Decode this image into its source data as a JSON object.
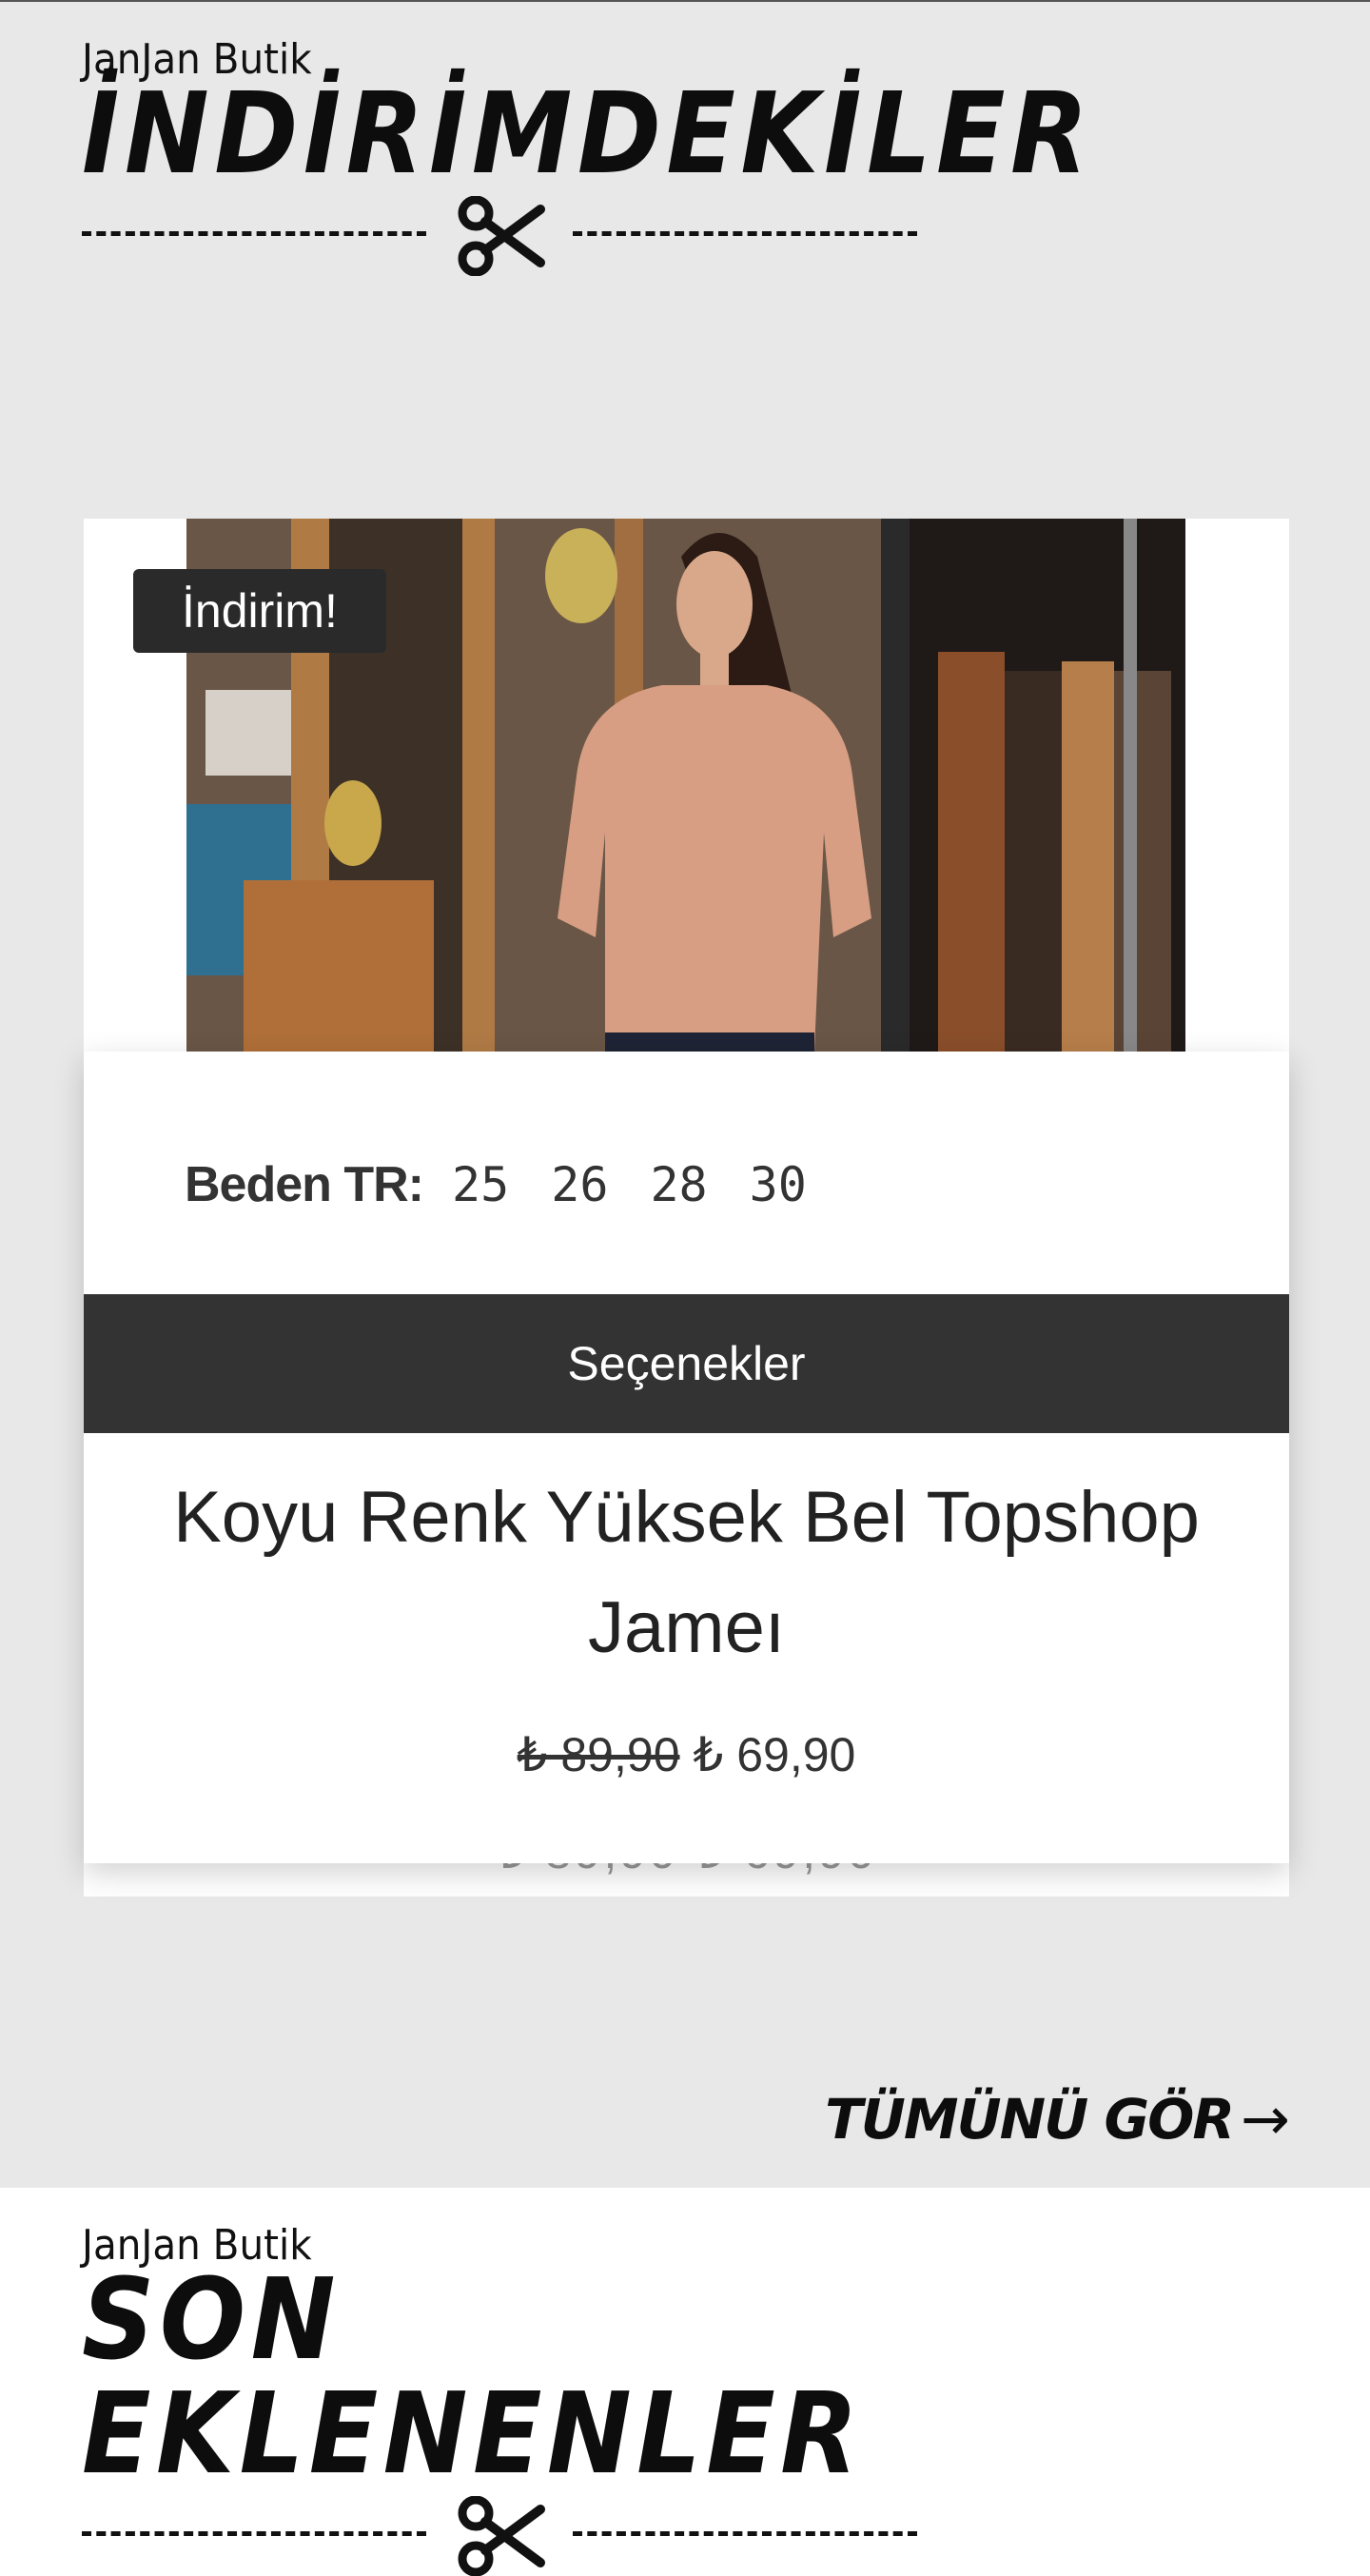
{
  "sale_section": {
    "brand": "JanJan Butik",
    "title": "İNDİRİMDEKİLER"
  },
  "product": {
    "badge": "İndirim!",
    "size_label": "Beden TR:",
    "sizes": [
      "25",
      "26",
      "28",
      "30"
    ],
    "options_label": "Seçenekler",
    "name": "Koyu Renk Yüksek Bel Topshop Jameı",
    "old_price": "₺ 89,90",
    "new_price": "₺ 69,90",
    "ghost_price": "₺ 89,90 ₺ 69,90"
  },
  "see_all": {
    "label": "TÜMÜNÜ GÖR",
    "arrow": "→"
  },
  "new_section": {
    "brand": "JanJan Butik",
    "title": "SON EKLENENLER"
  }
}
